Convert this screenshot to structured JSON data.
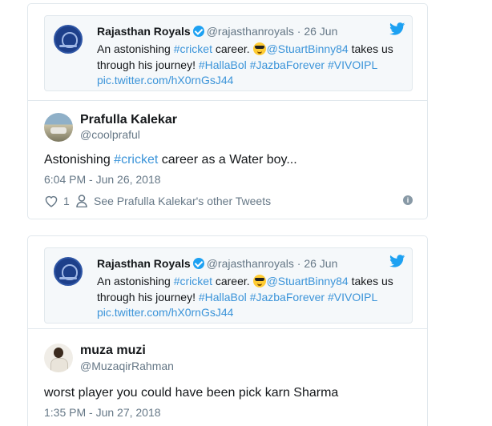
{
  "colors": {
    "link": "#3b94d9",
    "verified": "#1da1f2",
    "secondary_text": "#657786",
    "border": "#e1e8ed",
    "quoted_bg": "#f5f8fa"
  },
  "tweets": [
    {
      "quoted": {
        "name": "Rajasthan Royals",
        "handle": "@rajasthanroyals",
        "date": "· 26 Jun",
        "text_1": "An astonishing ",
        "hashtag_cricket": "#cricket",
        "text_2": " career. ",
        "mention": "@StuartBinny84",
        "text_3": " takes us through his journey! ",
        "hashtag_1": "#HallaBol",
        "hashtag_2": "#JazbaForever",
        "hashtag_3": "#VIVOIPL",
        "pic_link": "pic.twitter.com/hX0rnGsJ44",
        "avatar_icon": "rajasthan-royals-logo",
        "emoji_icon": "sunglasses-emoji"
      },
      "author": {
        "name": "Prafulla Kalekar",
        "handle": "@coolpraful"
      },
      "text_1": "Astonishing ",
      "hashtag": "#cricket",
      "text_2": " career as a Water boy...",
      "time": "6:04 PM - Jun 26, 2018",
      "like_count": "1",
      "other_tweets": "See Prafulla Kalekar's other Tweets"
    },
    {
      "quoted": {
        "name": "Rajasthan Royals",
        "handle": "@rajasthanroyals",
        "date": "· 26 Jun",
        "text_1": "An astonishing ",
        "hashtag_cricket": "#cricket",
        "text_2": " career. ",
        "mention": "@StuartBinny84",
        "text_3": " takes us through his journey! ",
        "hashtag_1": "#HallaBol",
        "hashtag_2": "#JazbaForever",
        "hashtag_3": "#VIVOIPL",
        "pic_link": "pic.twitter.com/hX0rnGsJ44",
        "avatar_icon": "rajasthan-royals-logo",
        "emoji_icon": "sunglasses-emoji"
      },
      "author": {
        "name": "muza muzi",
        "handle": "@MuzaqirRahman"
      },
      "text": "worst player you could have been pick karn Sharma",
      "time": "1:35 PM - Jun 27, 2018"
    }
  ]
}
